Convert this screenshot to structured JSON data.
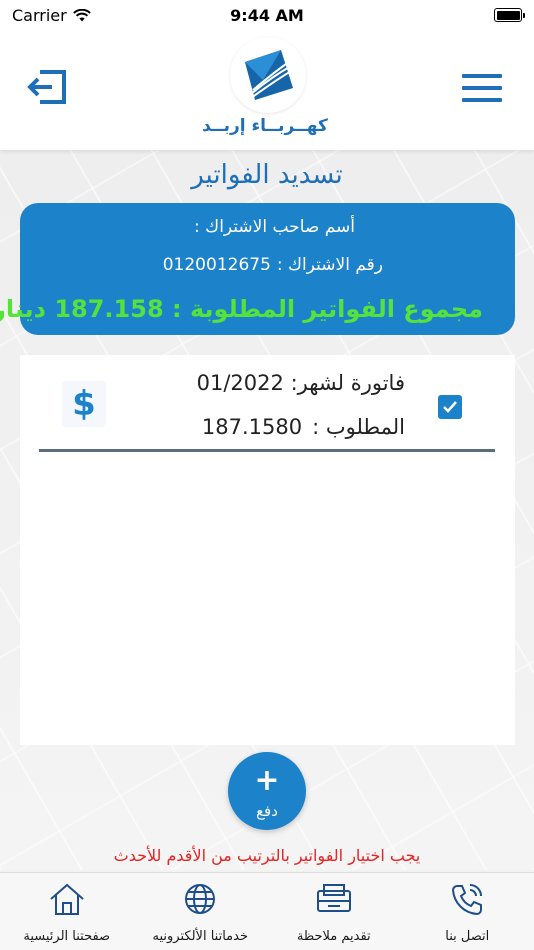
{
  "status_bar": {
    "carrier": "Carrier",
    "time": "9:44 AM"
  },
  "header": {
    "logo_text": "كهــربــاء إربــد"
  },
  "page": {
    "title": "تسديد الفواتير",
    "summary": {
      "owner_label": "أسم صاحب الاشتراك :",
      "subscription_label": "رقم الاشتراك  :",
      "subscription_number": "0120012675",
      "total_label": "مجموع الفواتير المطلوبة :",
      "total_value": "187.158",
      "currency": "دينار"
    },
    "bills": [
      {
        "month_label": "فاتورة لشهر:",
        "month_value": "01/2022",
        "amount_label": "المطلوب  :",
        "amount_value": "187.1580",
        "selected": true
      }
    ],
    "pay_button": {
      "plus": "+",
      "label": "دفع"
    },
    "order_note": "يجب اختيار الفواتير بالترتيب من الأقدم للأحدث"
  },
  "bottom_nav": [
    {
      "label": "اتصل بنا",
      "icon": "phone-icon"
    },
    {
      "label": "تقديم ملاحظة",
      "icon": "feedback-icon"
    },
    {
      "label": "خدماتنا الألكترونيه",
      "icon": "globe-icon"
    },
    {
      "label": "صفحتنا الرئيسية",
      "icon": "home-icon"
    }
  ],
  "colors": {
    "brand": "#1e6fb8",
    "card": "#1c82c9",
    "total_green": "#55e23c",
    "note_red": "#e52424"
  }
}
